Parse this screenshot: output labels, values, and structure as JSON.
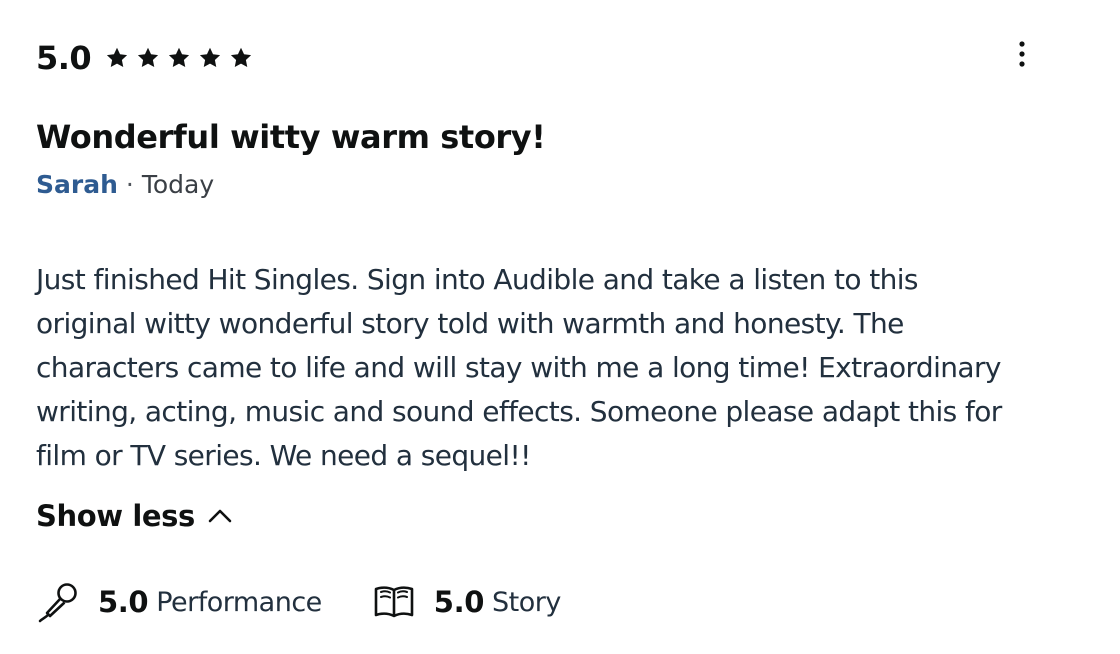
{
  "review": {
    "overall_score": "5.0",
    "star_count": 5,
    "star_icon": "star-icon",
    "more_icon": "more-vertical-icon",
    "title": "Wonderful witty warm story!",
    "author": "Sarah",
    "separator": "·",
    "date": "Today",
    "body_lines": [
      "Just finished Hit Singles. Sign into Audible and take a listen to this",
      "original witty wonderful story told with warmth and honesty. The",
      "characters came to life and will stay with me a long time! Extraordinary",
      "writing, acting, music and sound effects. Someone please adapt this for",
      "film or TV series. We need a sequel!!"
    ],
    "toggle_label": "Show less",
    "toggle_icon": "chevron-up-icon"
  },
  "sub_ratings": [
    {
      "icon": "microphone-icon",
      "score": "5.0",
      "label": "Performance"
    },
    {
      "icon": "book-icon",
      "score": "5.0",
      "label": "Story"
    }
  ],
  "colors": {
    "text_primary": "#0f1111",
    "text_body": "#22303e",
    "author_link": "#2e5b91",
    "background": "#ffffff"
  }
}
